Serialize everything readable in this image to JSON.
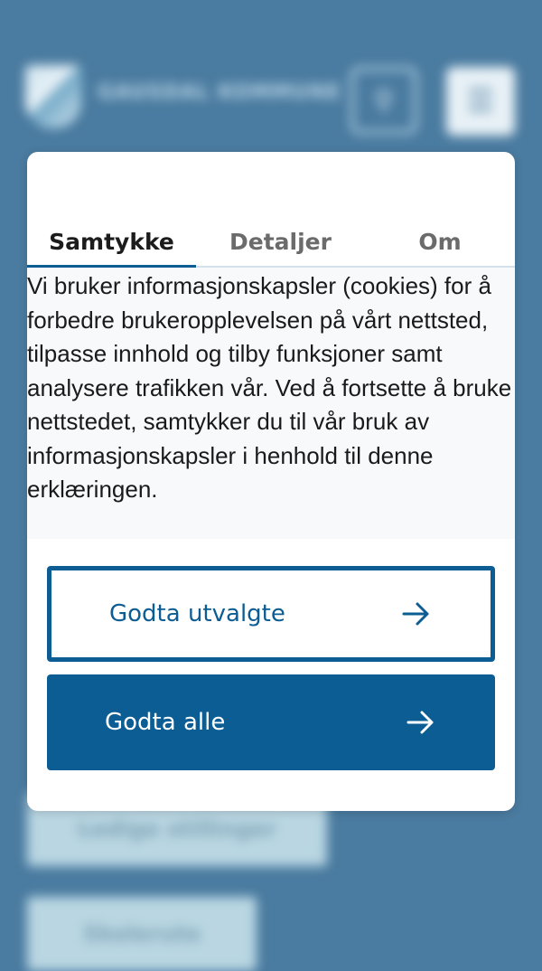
{
  "background": {
    "site_title": "GAUSDAL KOMMUNE",
    "chips": [
      "Ledige stillinger",
      "Skolerute"
    ]
  },
  "dialog": {
    "tabs": [
      {
        "label": "Samtykke",
        "active": true
      },
      {
        "label": "Detaljer",
        "active": false
      },
      {
        "label": "Om",
        "active": false
      }
    ],
    "body": "Vi bruker informasjonskapsler (cookies) for å forbedre brukeropplevelsen på vårt nettsted, tilpasse innhold og tilby funksjoner samt analysere trafikken vår. Ved å fortsette å bruke nettstedet, samtykker du til vår bruk av informasjonskapsler i henhold til denne erklæringen.",
    "accept_selected_label": "Godta utvalgte",
    "accept_all_label": "Godta alle"
  },
  "colors": {
    "accent": "#0b5d93",
    "overlay": "#4a7ba0"
  },
  "icons": [
    "logo-shield-icon",
    "search-icon",
    "menu-icon",
    "arrow-right-icon"
  ]
}
